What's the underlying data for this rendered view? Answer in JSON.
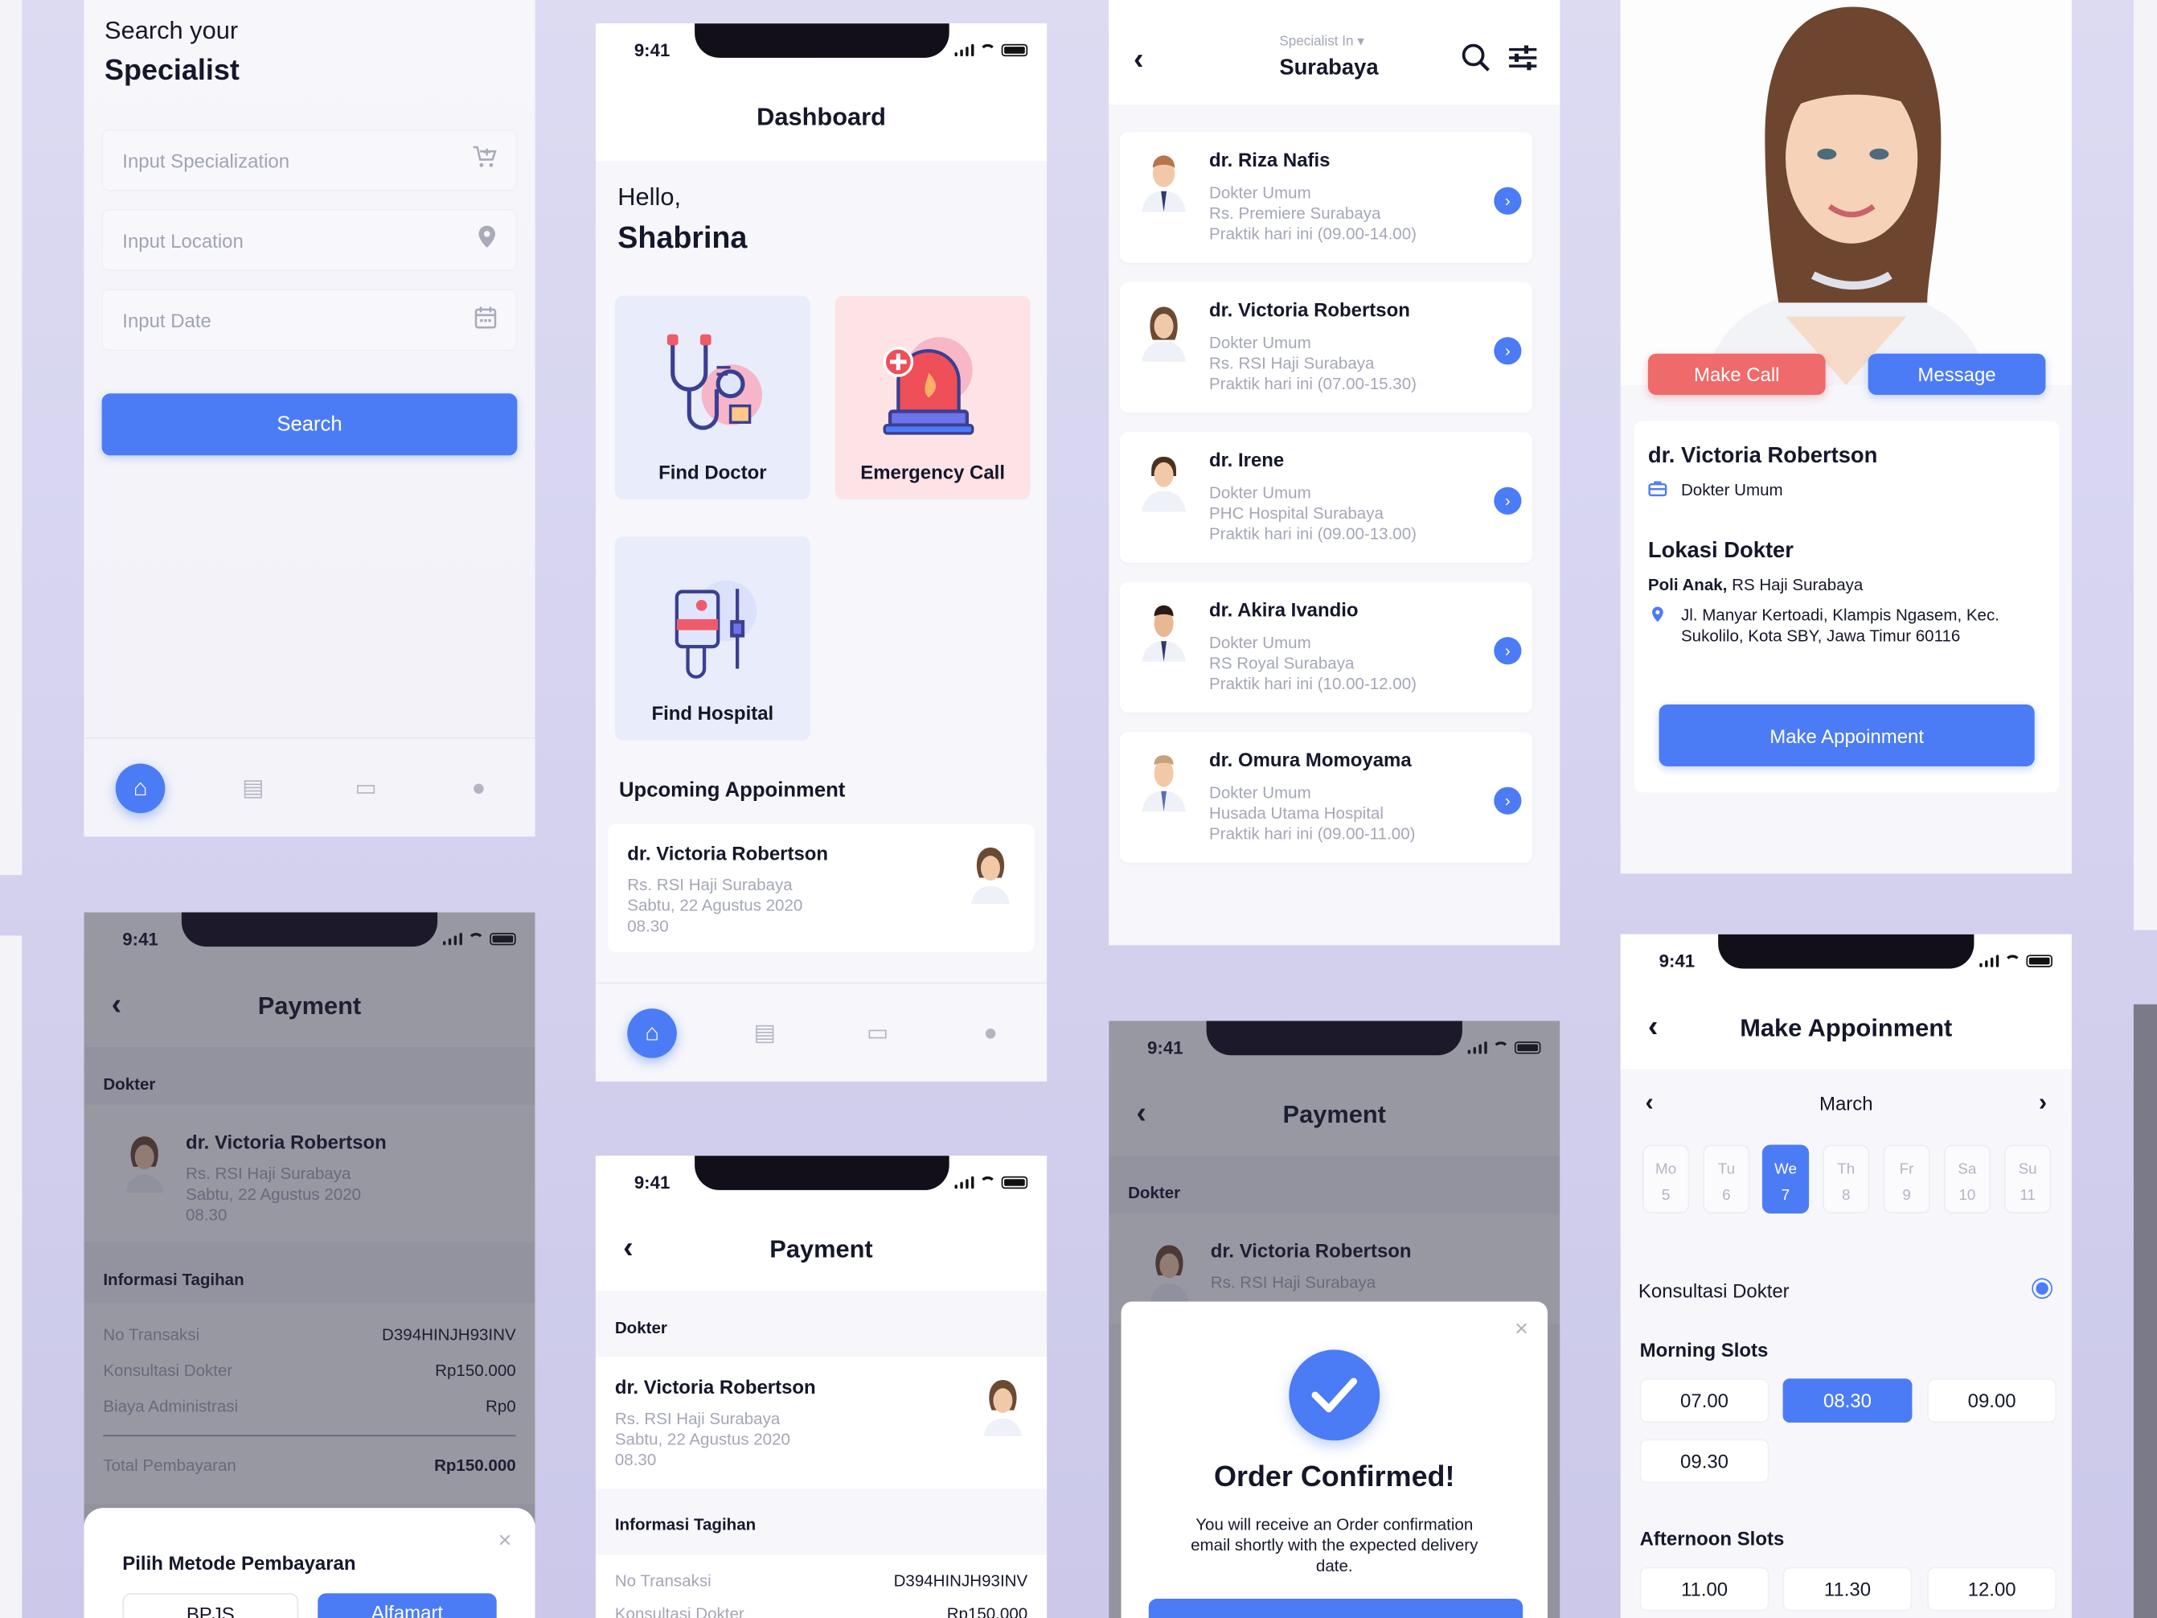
{
  "status_time": "9:41",
  "search_screen": {
    "heading_line1": "Search your",
    "heading_line2": "Specialist",
    "specialization_placeholder": "Input Specialization",
    "location_placeholder": "Input Location",
    "date_placeholder": "Input Date",
    "search_button": "Search"
  },
  "dashboard": {
    "title": "Dashboard",
    "greeting": "Hello,",
    "user_name": "Shabrina",
    "tiles": [
      {
        "label": "Find Doctor"
      },
      {
        "label": "Emergency Call"
      },
      {
        "label": "Find Hospital"
      }
    ],
    "upcoming_title": "Upcoming Appoinment",
    "upcoming": {
      "doctor": "dr. Victoria Robertson",
      "hospital": "Rs. RSI Haji Surabaya",
      "date": "Sabtu, 22 Agustus 2020",
      "time": "08.30"
    }
  },
  "doctor_list": {
    "label": "Specialist In",
    "city": "Surabaya",
    "doctors": [
      {
        "name": "dr. Riza Nafis",
        "type": "Dokter Umum",
        "hospital": "Rs. Premiere Surabaya",
        "schedule": "Praktik hari ini (09.00-14.00)"
      },
      {
        "name": "dr. Victoria Robertson",
        "type": "Dokter Umum",
        "hospital": "Rs. RSI Haji Surabaya",
        "schedule": "Praktik hari ini (07.00-15.30)"
      },
      {
        "name": "dr. Irene",
        "type": "Dokter Umum",
        "hospital": "PHC Hospital Surabaya",
        "schedule": "Praktik hari ini (09.00-13.00)"
      },
      {
        "name": "dr. Akira Ivandio",
        "type": "Dokter Umum",
        "hospital": "RS Royal Surabaya",
        "schedule": "Praktik hari ini (10.00-12.00)"
      },
      {
        "name": "dr. Omura Momoyama",
        "type": "Dokter Umum",
        "hospital": "Husada Utama Hospital",
        "schedule": "Praktik hari ini (09.00-11.00)"
      }
    ]
  },
  "doctor_profile": {
    "call_button": "Make Call",
    "message_button": "Message",
    "name": "dr. Victoria Robertson",
    "type": "Dokter Umum",
    "location_title": "Lokasi Dokter",
    "poli": "Poli Anak,",
    "hospital": "RS Haji Surabaya",
    "address_line1": "Jl. Manyar Kertoadi, Klampis Ngasem, Kec.",
    "address_line2": "Sukolilo, Kota SBY, Jawa Timur 60116",
    "appointment_button": "Make Appoinment"
  },
  "payment": {
    "title": "Payment",
    "doctor_section": "Dokter",
    "doctor": "dr. Victoria Robertson",
    "hospital": "Rs. RSI Haji Surabaya",
    "date": "Sabtu, 22 Agustus 2020",
    "time": "08.30",
    "bill_section": "Informasi Tagihan",
    "rows": [
      {
        "label": "No Transaksi",
        "value": "D394HINJH93INV"
      },
      {
        "label": "Konsultasi Dokter",
        "value": "Rp150.000"
      },
      {
        "label": "Biaya Administrasi",
        "value": "Rp0"
      }
    ],
    "total_label": "Total Pembayaran",
    "total_value": "Rp150.000",
    "method_title": "Pilih Metode Pembayaran",
    "methods": [
      "BPJS",
      "Alfamart"
    ]
  },
  "order_confirmed": {
    "title": "Order Confirmed!",
    "message_line1": "You will receive an Order confirmation",
    "message_line2": "email shortly with the expected delivery",
    "message_line3": "date."
  },
  "make_appointment": {
    "title": "Make Appoinment",
    "month": "March",
    "days": [
      {
        "name": "Mo",
        "num": "5"
      },
      {
        "name": "Tu",
        "num": "6"
      },
      {
        "name": "We",
        "num": "7"
      },
      {
        "name": "Th",
        "num": "8"
      },
      {
        "name": "Fr",
        "num": "9"
      },
      {
        "name": "Sa",
        "num": "10"
      },
      {
        "name": "Su",
        "num": "11"
      }
    ],
    "selected_day": "We",
    "consult_label": "Konsultasi Dokter",
    "morning_title": "Morning Slots",
    "morning_slots": [
      "07.00",
      "08.30",
      "09.00",
      "09.30"
    ],
    "selected_slot": "08.30",
    "afternoon_title": "Afternoon Slots",
    "afternoon_slots": [
      "11.00",
      "11.30",
      "12.00"
    ]
  },
  "colors": {
    "primary": "#4C7CF5",
    "danger": "#EF6A6A",
    "text": "#15172B",
    "muted": "#A4A7B6"
  }
}
